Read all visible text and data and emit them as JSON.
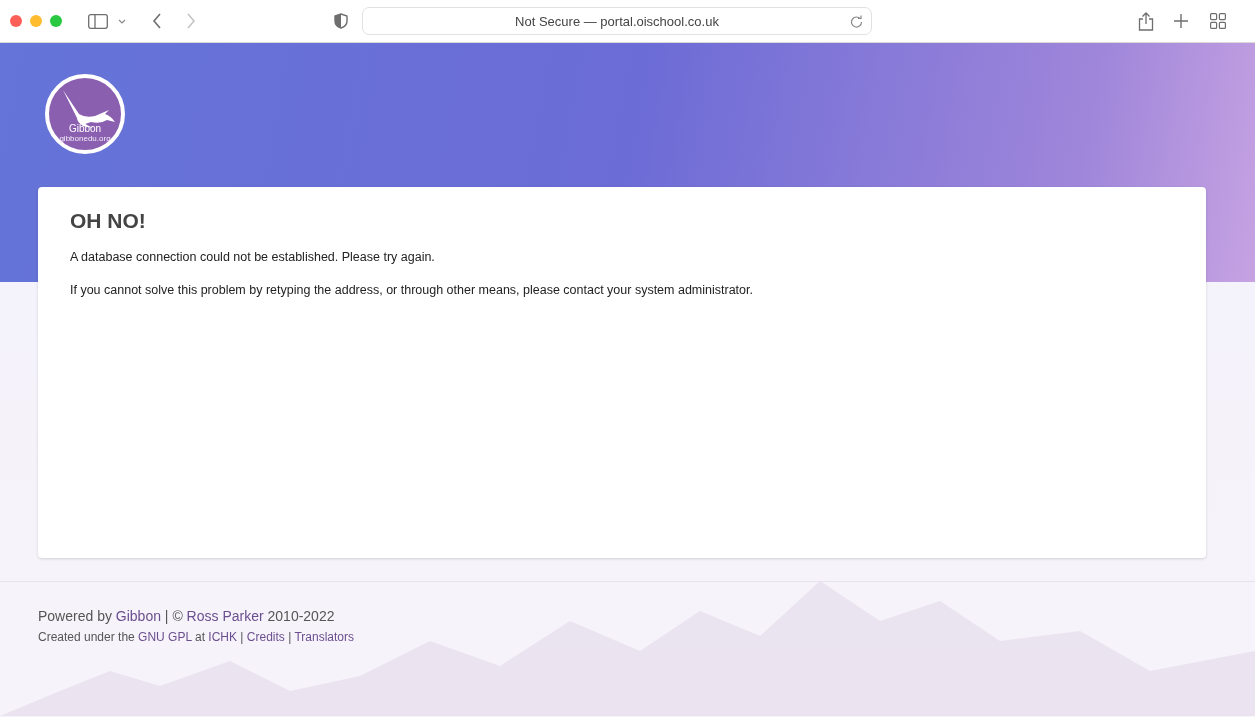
{
  "browser": {
    "address": "Not Secure — portal.oischool.co.uk",
    "back_disabled": false,
    "forward_disabled": true
  },
  "logo": {
    "name": "Gibbon",
    "url": "gibbonedu.org"
  },
  "error": {
    "title": "OH NO!",
    "paragraphs": [
      "A database connection could not be established. Please try again.",
      "If you cannot solve this problem by retyping the address, or through other means, please contact your system administrator."
    ]
  },
  "footer": {
    "lines": [
      [
        {
          "kind": "text",
          "text": "Powered by "
        },
        {
          "kind": "link",
          "text": "Gibbon"
        },
        {
          "kind": "text",
          "text": " | © "
        },
        {
          "kind": "link",
          "text": "Ross Parker"
        },
        {
          "kind": "text",
          "text": " 2010-2022"
        }
      ],
      [
        {
          "kind": "text",
          "text": "Created under the "
        },
        {
          "kind": "link",
          "text": "GNU GPL"
        },
        {
          "kind": "text",
          "text": " at "
        },
        {
          "kind": "link",
          "text": "ICHK"
        },
        {
          "kind": "text",
          "text": " | "
        },
        {
          "kind": "link",
          "text": "Credits"
        },
        {
          "kind": "text",
          "text": " | "
        },
        {
          "kind": "link",
          "text": "Translators"
        }
      ]
    ]
  }
}
